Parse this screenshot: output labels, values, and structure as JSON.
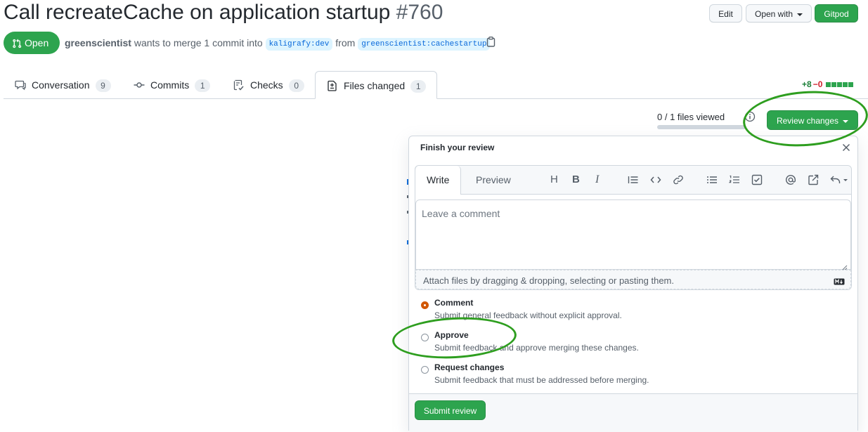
{
  "header": {
    "title": "Call recreateCache on application startup",
    "number": "#760",
    "edit_label": "Edit",
    "open_with_label": "Open with",
    "gitpod_label": "Gitpod"
  },
  "state": {
    "badge": "Open",
    "author": "greenscientist",
    "action_text": "wants to merge 1 commit into",
    "base_branch": "kaligrafy:dev",
    "from_text": "from",
    "head_branch": "greenscientist:cachestartup"
  },
  "tabs": [
    {
      "label": "Conversation",
      "count": "9"
    },
    {
      "label": "Commits",
      "count": "1"
    },
    {
      "label": "Checks",
      "count": "0"
    },
    {
      "label": "Files changed",
      "count": "1"
    }
  ],
  "diffstat": {
    "additions": "+8",
    "deletions": "−0"
  },
  "files_viewed": {
    "text": "0 / 1 files viewed",
    "progress": 0
  },
  "review_button": "Review changes",
  "review_panel": {
    "title": "Finish your review",
    "write_tab": "Write",
    "preview_tab": "Preview",
    "comment_placeholder": "Leave a comment",
    "attach_text": "Attach files by dragging & dropping, selecting or pasting them.",
    "options": [
      {
        "label": "Comment",
        "desc": "Submit general feedback without explicit approval.",
        "checked": true
      },
      {
        "label": "Approve",
        "desc": "Submit feedback and approve merging these changes.",
        "checked": false
      },
      {
        "label": "Request changes",
        "desc": "Submit feedback that must be addressed before merging.",
        "checked": false
      }
    ],
    "submit_label": "Submit review"
  },
  "colors": {
    "primary_green": "#2da44e",
    "annotation_green": "#2e9e1f",
    "link_blue": "#0969da",
    "checked_radio": "#d15704"
  }
}
